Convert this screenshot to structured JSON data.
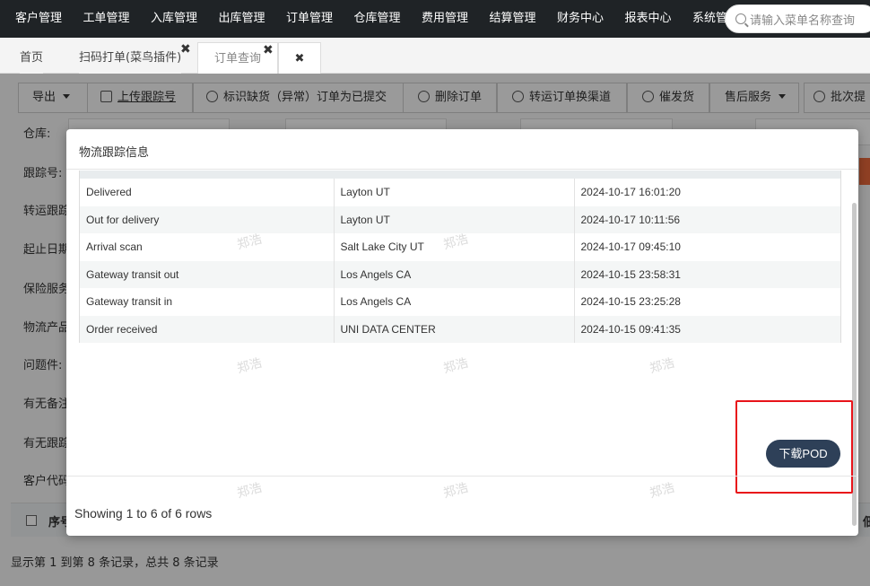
{
  "topnav": {
    "menu": [
      "客户管理",
      "工单管理",
      "入库管理",
      "出库管理",
      "订单管理",
      "仓库管理",
      "费用管理",
      "结算管理",
      "财务中心",
      "报表中心",
      "系统管"
    ],
    "search_placeholder": "请输入菜单名称查询"
  },
  "tabs": [
    {
      "label": "首页"
    },
    {
      "label": "扫码打单(菜鸟插件)"
    },
    {
      "label": "订单查询"
    }
  ],
  "tab_close_glyph": "✖",
  "toolbar": {
    "buttons": [
      "导出",
      "上传跟踪号",
      "标识缺货（异常）订单为已提交",
      "删除订单",
      "转运订单换渠道",
      "催发货",
      "售后服务",
      "批次提"
    ]
  },
  "filters": {
    "warehouse_label": "仓库:",
    "tracking_label": "跟踪号:",
    "transfer_label": "转运跟踪",
    "date_label": "起止日期",
    "insurance_label": "保险服务",
    "product_label": "物流产品",
    "problem_label": "问题件:",
    "remark_label": "有无备注",
    "has_tracking_label": "有无跟踪",
    "customer_label": "客户代码"
  },
  "table_header": {
    "seq": "序号",
    "right": "佃"
  },
  "bottom_records": "显示第 1 到第 8 条记录，总共 8 条记录",
  "modal": {
    "title": "物流跟踪信息",
    "rows": [
      {
        "status": "Delivered",
        "location": "Layton UT",
        "time": "2024-10-17 16:01:20"
      },
      {
        "status": "Out for delivery",
        "location": "Layton UT",
        "time": "2024-10-17 10:11:56"
      },
      {
        "status": "Arrival scan",
        "location": "Salt Lake City UT",
        "time": "2024-10-17 09:45:10"
      },
      {
        "status": "Gateway transit out",
        "location": "Los Angels CA",
        "time": "2024-10-15 23:58:31"
      },
      {
        "status": "Gateway transit in",
        "location": "Los Angels CA",
        "time": "2024-10-15 23:25:28"
      },
      {
        "status": "Order received",
        "location": "UNI DATA CENTER",
        "time": "2024-10-15 09:41:35"
      }
    ],
    "download_button": "下载POD",
    "showing": "Showing 1 to 6 of 6 rows",
    "watermark": "郑浩"
  },
  "colors": {
    "nav_bg": "#1f2326",
    "pod_button": "#2e4058",
    "highlight": "#e8141a",
    "accent": "#e8683a"
  }
}
